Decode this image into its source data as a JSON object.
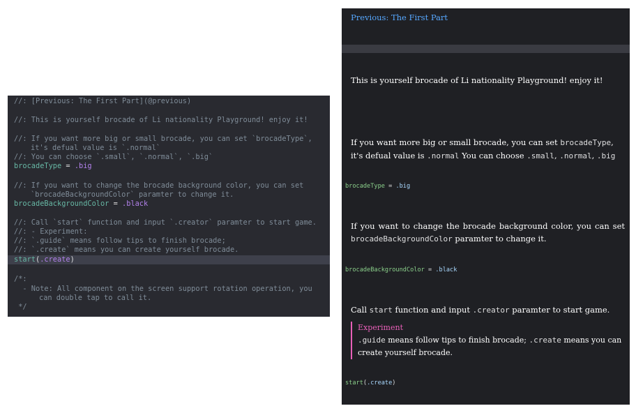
{
  "editor": {
    "lines": [
      "//: [Previous: The First Part](@previous)",
      "//: This is yourself brocade of Li nationality Playground! enjoy it!",
      "//: If you want more big or small brocade, you can set `brocadeType`,",
      "it's defual value is `.normal`",
      "//: You can choose `.small`, `.normal`, `.big`",
      "//: If you want to change the brocade background color, you can set",
      "`brocadeBackgroundColor` paramter to change it.",
      "//: Call `start` function and input `.creator` paramter to start game.",
      "//: - Experiment:",
      "//: `.guide` means follow tips to finish brocade;",
      "//: `.create` means you can create yourself brocade.",
      "/*:",
      "  - Note: All component on the screen support rotation operation, you",
      "can double tap to call it.",
      " */"
    ],
    "code": {
      "brocade_type_name": "brocadeType",
      "brocade_type_value": ".big",
      "bg_color_name": "brocadeBackgroundColor",
      "bg_color_value": ".black",
      "start_fn": "start",
      "start_arg": ".create",
      "assign_op": " = "
    }
  },
  "rendered": {
    "previous_link": "Previous: The First Part",
    "intro": "This is yourself brocade of Li nationality Playground! enjoy it!",
    "size_para": {
      "t1": "If you want more big or small brocade, you can set ",
      "m1": "brocadeType",
      "t2": ", it's defual value is ",
      "m2": ".normal",
      "t3": " You can choose ",
      "m3": ".small",
      "t4": ", ",
      "m4": ".normal",
      "t5": ", ",
      "m5": ".big"
    },
    "code_brocade_type": {
      "name": "brocadeType",
      "op": " = ",
      "value": ".big"
    },
    "color_para": {
      "t1": "If you want to change the brocade background color, you can set ",
      "m1": "brocadeBackgroundColor",
      "t2": " paramter to change it."
    },
    "code_bg_color": {
      "name": "brocadeBackgroundColor",
      "op": " = ",
      "value": ".black"
    },
    "start_para": {
      "t1": "Call ",
      "m1": "start",
      "t2": " function and input ",
      "m2": ".creator",
      "t3": " paramter to start game."
    },
    "experiment": {
      "title": "Experiment",
      "m1": ".guide",
      "t1": " means follow tips to finish brocade; ",
      "m2": ".create",
      "t2": " means you can create yourself brocade."
    },
    "code_start": {
      "fn": "start",
      "open": "(",
      "arg": ".create",
      "close": ")"
    }
  },
  "colors": {
    "editor_bg": "#292a30",
    "rendered_bg": "#1f2024",
    "link": "#57a8ff",
    "experiment_accent": "#e85fb8",
    "comment": "#7f8c98"
  }
}
